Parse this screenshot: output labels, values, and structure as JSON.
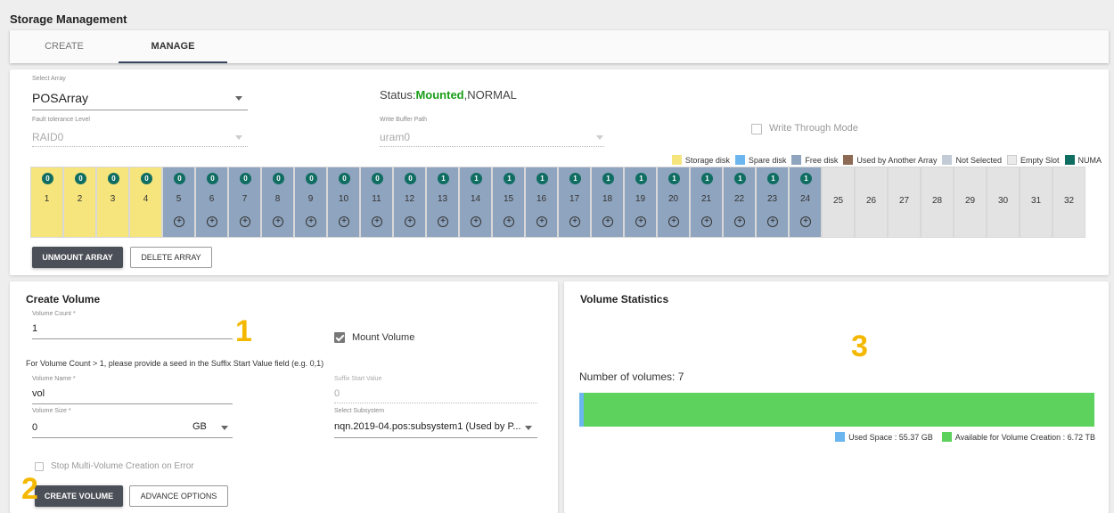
{
  "page_title": "Storage Management",
  "tabs": [
    {
      "label": "CREATE"
    },
    {
      "label": "MANAGE"
    }
  ],
  "array_panel": {
    "select_array_label": "Select Array",
    "select_array_value": "POSArray",
    "status_prefix": "Status:",
    "status_mounted": "Mounted",
    "status_suffix": ",NORMAL",
    "fault_tolerance_label": "Fault tolerance Level",
    "fault_tolerance_value": "RAID0",
    "write_buffer_label": "Write Buffer Path",
    "write_buffer_value": "uram0",
    "write_through_label": "Write Through Mode",
    "legend": [
      {
        "label": "Storage disk",
        "color": "#f6e57c"
      },
      {
        "label": "Spare disk",
        "color": "#6cb6ef"
      },
      {
        "label": "Free disk",
        "color": "#8fa4be"
      },
      {
        "label": "Used by Another Array",
        "color": "#8c6a54"
      },
      {
        "label": "Not Selected",
        "color": "#c3ccd6"
      },
      {
        "label": "Empty Slot",
        "color": "#eaeaea"
      },
      {
        "label": "NUMA",
        "color": "#0f6d62"
      }
    ],
    "slots": [
      {
        "num": "1",
        "state": "storage",
        "numa": "0",
        "plus": false
      },
      {
        "num": "2",
        "state": "storage",
        "numa": "0",
        "plus": false
      },
      {
        "num": "3",
        "state": "storage",
        "numa": "0",
        "plus": false
      },
      {
        "num": "4",
        "state": "storage",
        "numa": "0",
        "plus": false
      },
      {
        "num": "5",
        "state": "free",
        "numa": "0",
        "plus": true
      },
      {
        "num": "6",
        "state": "free",
        "numa": "0",
        "plus": true
      },
      {
        "num": "7",
        "state": "free",
        "numa": "0",
        "plus": true
      },
      {
        "num": "8",
        "state": "free",
        "numa": "0",
        "plus": true
      },
      {
        "num": "9",
        "state": "free",
        "numa": "0",
        "plus": true
      },
      {
        "num": "10",
        "state": "free",
        "numa": "0",
        "plus": true
      },
      {
        "num": "11",
        "state": "free",
        "numa": "0",
        "plus": true
      },
      {
        "num": "12",
        "state": "free",
        "numa": "0",
        "plus": true
      },
      {
        "num": "13",
        "state": "free",
        "numa": "1",
        "plus": true
      },
      {
        "num": "14",
        "state": "free",
        "numa": "1",
        "plus": true
      },
      {
        "num": "15",
        "state": "free",
        "numa": "1",
        "plus": true
      },
      {
        "num": "16",
        "state": "free",
        "numa": "1",
        "plus": true
      },
      {
        "num": "17",
        "state": "free",
        "numa": "1",
        "plus": true
      },
      {
        "num": "18",
        "state": "free",
        "numa": "1",
        "plus": true
      },
      {
        "num": "19",
        "state": "free",
        "numa": "1",
        "plus": true
      },
      {
        "num": "20",
        "state": "free",
        "numa": "1",
        "plus": true
      },
      {
        "num": "21",
        "state": "free",
        "numa": "1",
        "plus": true
      },
      {
        "num": "22",
        "state": "free",
        "numa": "1",
        "plus": true
      },
      {
        "num": "23",
        "state": "free",
        "numa": "1",
        "plus": true
      },
      {
        "num": "24",
        "state": "free",
        "numa": "1",
        "plus": true
      },
      {
        "num": "25",
        "state": "empty",
        "numa": "",
        "plus": false
      },
      {
        "num": "26",
        "state": "empty",
        "numa": "",
        "plus": false
      },
      {
        "num": "27",
        "state": "empty",
        "numa": "",
        "plus": false
      },
      {
        "num": "28",
        "state": "empty",
        "numa": "",
        "plus": false
      },
      {
        "num": "29",
        "state": "empty",
        "numa": "",
        "plus": false
      },
      {
        "num": "30",
        "state": "empty",
        "numa": "",
        "plus": false
      },
      {
        "num": "31",
        "state": "empty",
        "numa": "",
        "plus": false
      },
      {
        "num": "32",
        "state": "empty",
        "numa": "",
        "plus": false
      }
    ],
    "plus_symbol": "+",
    "unmount_label": "UNMOUNT ARRAY",
    "delete_label": "DELETE ARRAY"
  },
  "create_volume": {
    "title": "Create Volume",
    "volume_count_label": "Volume Count *",
    "volume_count_value": "1",
    "mount_volume_label": "Mount Volume",
    "hint": "For Volume Count > 1, please provide a seed in the Suffix Start Value field (e.g. 0,1)",
    "volume_name_label": "Volume Name *",
    "volume_name_value": "vol",
    "suffix_label": "Suffix Start Value",
    "suffix_value": "0",
    "volume_size_label": "Volume Size *",
    "volume_size_value": "0",
    "unit_value": "GB",
    "subsystem_label": "Select Subsystem",
    "subsystem_value": "nqn.2019-04.pos:subsystem1 (Used by P...",
    "stop_on_error_label": "Stop Multi-Volume Creation on Error",
    "create_label": "CREATE VOLUME",
    "advance_label": "ADVANCE OPTIONS"
  },
  "volume_stats": {
    "title": "Volume Statistics",
    "count_text": "Number of volumes: 7",
    "used_label": "Used Space : 55.37 GB",
    "available_label": "Available for Volume Creation : 6.72 TB",
    "used_color": "#6cb6ef",
    "available_color": "#5dd25d"
  },
  "annotations": {
    "one": "1",
    "two": "2",
    "three": "3"
  }
}
